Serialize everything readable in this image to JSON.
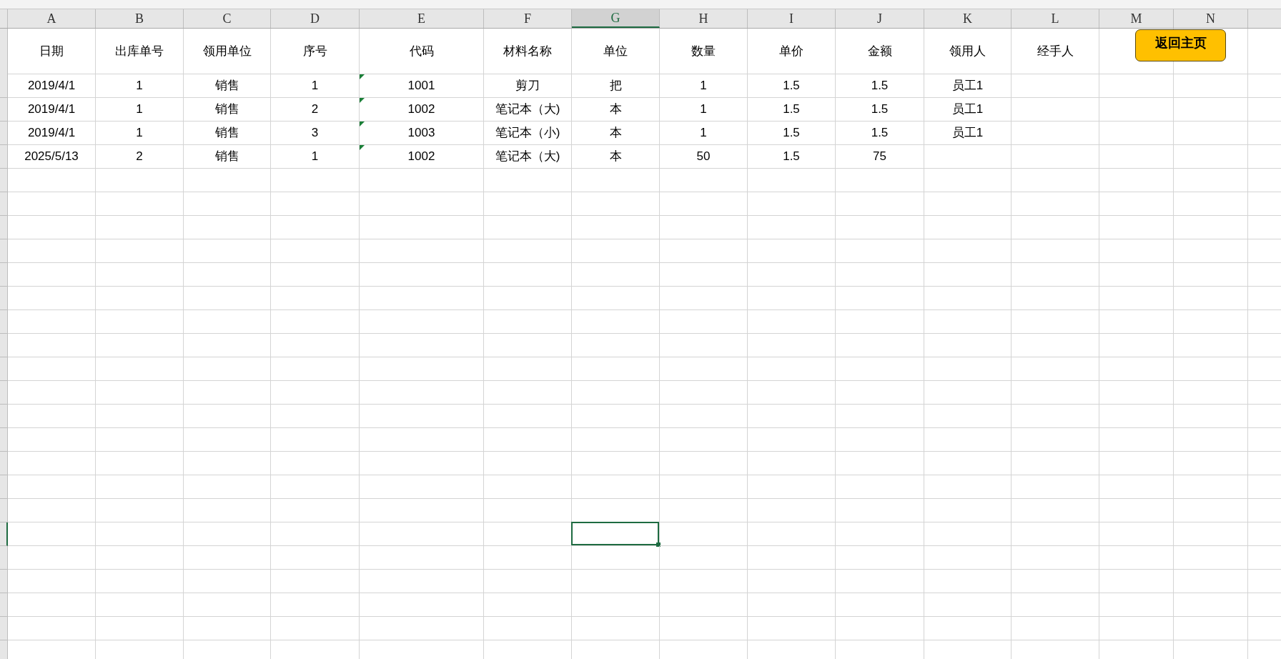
{
  "columns": [
    {
      "letter": "A",
      "selected": false
    },
    {
      "letter": "B",
      "selected": false
    },
    {
      "letter": "C",
      "selected": false
    },
    {
      "letter": "D",
      "selected": false
    },
    {
      "letter": "E",
      "selected": false
    },
    {
      "letter": "F",
      "selected": false
    },
    {
      "letter": "G",
      "selected": true
    },
    {
      "letter": "H",
      "selected": false
    },
    {
      "letter": "I",
      "selected": false
    },
    {
      "letter": "J",
      "selected": false
    },
    {
      "letter": "K",
      "selected": false
    },
    {
      "letter": "L",
      "selected": false
    },
    {
      "letter": "M",
      "selected": false
    },
    {
      "letter": "N",
      "selected": false
    }
  ],
  "header_row": [
    "日期",
    "出库单号",
    "领用单位",
    "序号",
    "代码",
    "材料名称",
    "单位",
    "数量",
    "单价",
    "金额",
    "领用人",
    "经手人"
  ],
  "rows": [
    {
      "cells": [
        "2019/4/1",
        "1",
        "销售",
        "1",
        "1001",
        "剪刀",
        "把",
        "1",
        "1.5",
        "1.5",
        "员工1"
      ],
      "code_flag": true
    },
    {
      "cells": [
        "2019/4/1",
        "1",
        "销售",
        "2",
        "1002",
        "笔记本（大)",
        "本",
        "1",
        "1.5",
        "1.5",
        "员工1"
      ],
      "code_flag": true
    },
    {
      "cells": [
        "2019/4/1",
        "1",
        "销售",
        "3",
        "1003",
        "笔记本（小)",
        "本",
        "1",
        "1.5",
        "1.5",
        "员工1"
      ],
      "code_flag": true
    },
    {
      "cells": [
        "2025/5/13",
        "2",
        "销售",
        "1",
        "1002",
        "笔记本（大)",
        "本",
        "50",
        "1.5",
        "75"
      ],
      "code_flag": true
    }
  ],
  "button": {
    "label": "返回主页"
  }
}
